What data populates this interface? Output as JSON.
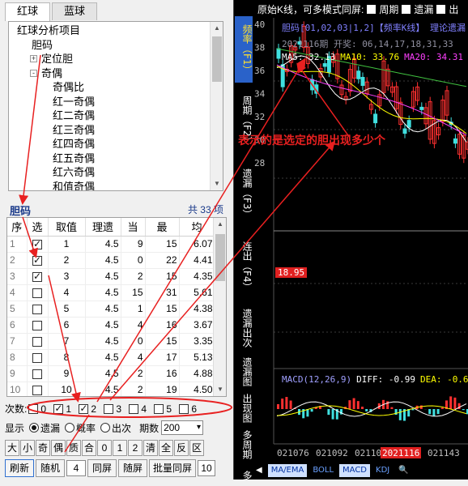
{
  "left_panel": {
    "tabs": [
      "红球",
      "蓝球"
    ],
    "tree": [
      {
        "label": "红球分析项目",
        "indent": 0,
        "exp": null
      },
      {
        "label": "胆码",
        "indent": 1,
        "exp": null
      },
      {
        "label": "定位胆",
        "indent": 1,
        "exp": "+"
      },
      {
        "label": "奇偶",
        "indent": 1,
        "exp": "-"
      },
      {
        "label": "奇偶比",
        "indent": 2,
        "exp": null
      },
      {
        "label": "红一奇偶",
        "indent": 2,
        "exp": null
      },
      {
        "label": "红二奇偶",
        "indent": 2,
        "exp": null
      },
      {
        "label": "红三奇偶",
        "indent": 2,
        "exp": null
      },
      {
        "label": "红四奇偶",
        "indent": 2,
        "exp": null
      },
      {
        "label": "红五奇偶",
        "indent": 2,
        "exp": null
      },
      {
        "label": "红六奇偶",
        "indent": 2,
        "exp": null
      },
      {
        "label": "和值奇偶",
        "indent": 2,
        "exp": null
      }
    ],
    "section_title": "胆码",
    "count_text": "共 33 项",
    "table": {
      "headers": [
        "序",
        "选",
        "取值",
        "理遗",
        "当",
        "最",
        "均"
      ],
      "rows": [
        {
          "seq": "1",
          "checked": true,
          "val": "1",
          "li": "4.5",
          "cur": "9",
          "max": "15",
          "avg": "6.07"
        },
        {
          "seq": "2",
          "checked": true,
          "val": "2",
          "li": "4.5",
          "cur": "0",
          "max": "22",
          "avg": "4.41"
        },
        {
          "seq": "3",
          "checked": true,
          "val": "3",
          "li": "4.5",
          "cur": "2",
          "max": "15",
          "avg": "4.35"
        },
        {
          "seq": "4",
          "checked": false,
          "val": "4",
          "li": "4.5",
          "cur": "15",
          "max": "31",
          "avg": "5.61"
        },
        {
          "seq": "5",
          "checked": false,
          "val": "5",
          "li": "4.5",
          "cur": "1",
          "max": "15",
          "avg": "4.38"
        },
        {
          "seq": "6",
          "checked": false,
          "val": "6",
          "li": "4.5",
          "cur": "4",
          "max": "16",
          "avg": "3.67"
        },
        {
          "seq": "7",
          "checked": false,
          "val": "7",
          "li": "4.5",
          "cur": "0",
          "max": "15",
          "avg": "3.35"
        },
        {
          "seq": "8",
          "checked": false,
          "val": "8",
          "li": "4.5",
          "cur": "4",
          "max": "17",
          "avg": "5.13"
        },
        {
          "seq": "9",
          "checked": false,
          "val": "9",
          "li": "4.5",
          "cur": "2",
          "max": "16",
          "avg": "4.88"
        },
        {
          "seq": "10",
          "checked": false,
          "val": "10",
          "li": "4.5",
          "cur": "2",
          "max": "19",
          "avg": "4.50"
        }
      ]
    },
    "times_label": "次数:",
    "times": [
      {
        "label": "0",
        "checked": false
      },
      {
        "label": "1",
        "checked": true
      },
      {
        "label": "2",
        "checked": true
      },
      {
        "label": "3",
        "checked": false
      },
      {
        "label": "4",
        "checked": false
      },
      {
        "label": "5",
        "checked": false
      },
      {
        "label": "6",
        "checked": false
      }
    ],
    "display_label": "显示",
    "display_options": [
      {
        "label": "遗漏",
        "on": true
      },
      {
        "label": "概率",
        "on": false
      },
      {
        "label": "出次",
        "on": false
      }
    ],
    "periods_label": "期数",
    "periods_value": "200",
    "quick_keys": [
      "大",
      "小",
      "奇",
      "偶",
      "质",
      "合",
      "0",
      "1",
      "2",
      "清",
      "全",
      "反",
      "区"
    ],
    "actions": {
      "refresh": "刷新",
      "random": "随机",
      "random_count": "4",
      "same_screen": "同屏",
      "with_screen": "随屏",
      "batch_same": "批量同屏",
      "batch_count": "10"
    }
  },
  "sidebar": [
    "频率（F1）",
    "周期（F2）",
    "遗漏（F3）",
    "连出（F4）",
    "遗漏出次",
    "遗漏图",
    "出现图",
    "多周期",
    "多"
  ],
  "chart": {
    "topbar": {
      "lead": "原始K线，可多模式同屏:",
      "opts": [
        "周期",
        "遗漏",
        "出"
      ]
    },
    "title_line": "胆码[01,02,03|1,2]【频率K线】 理论遗漏",
    "sub_line": "2021116期 开奖: 06,14,17,18,31,33",
    "ma_labels": [
      {
        "text": "MA5: 32.13",
        "color": "#ffffff"
      },
      {
        "text": "MA10: 33.76",
        "color": "#ffff00"
      },
      {
        "text": "MA20: 34.31",
        "color": "#ff40ff"
      }
    ],
    "y_ticks": [
      "40",
      "38",
      "36",
      "34",
      "32",
      "30",
      "28"
    ],
    "price_tag": "18.95",
    "annotation": "表示的是选定的胆出现多少个",
    "macd_labels": [
      {
        "text": "MACD(12,26,9)",
        "color": "#a0a0ff"
      },
      {
        "text": "DIFF: -0.99",
        "color": "#ffffff"
      },
      {
        "text": "DEA: -0.6",
        "color": "#ffff00"
      }
    ],
    "x_ticks": [
      "021076",
      "021092",
      "021109",
      "2021116",
      "021143"
    ],
    "bottom_buttons": [
      "MA/EMA",
      "BOLL",
      "MACD",
      "KDJ"
    ],
    "colors": {
      "up": "#ff3030",
      "down": "#40e0e0",
      "arrow": "#e82020",
      "accent": "#2a62c9"
    }
  }
}
